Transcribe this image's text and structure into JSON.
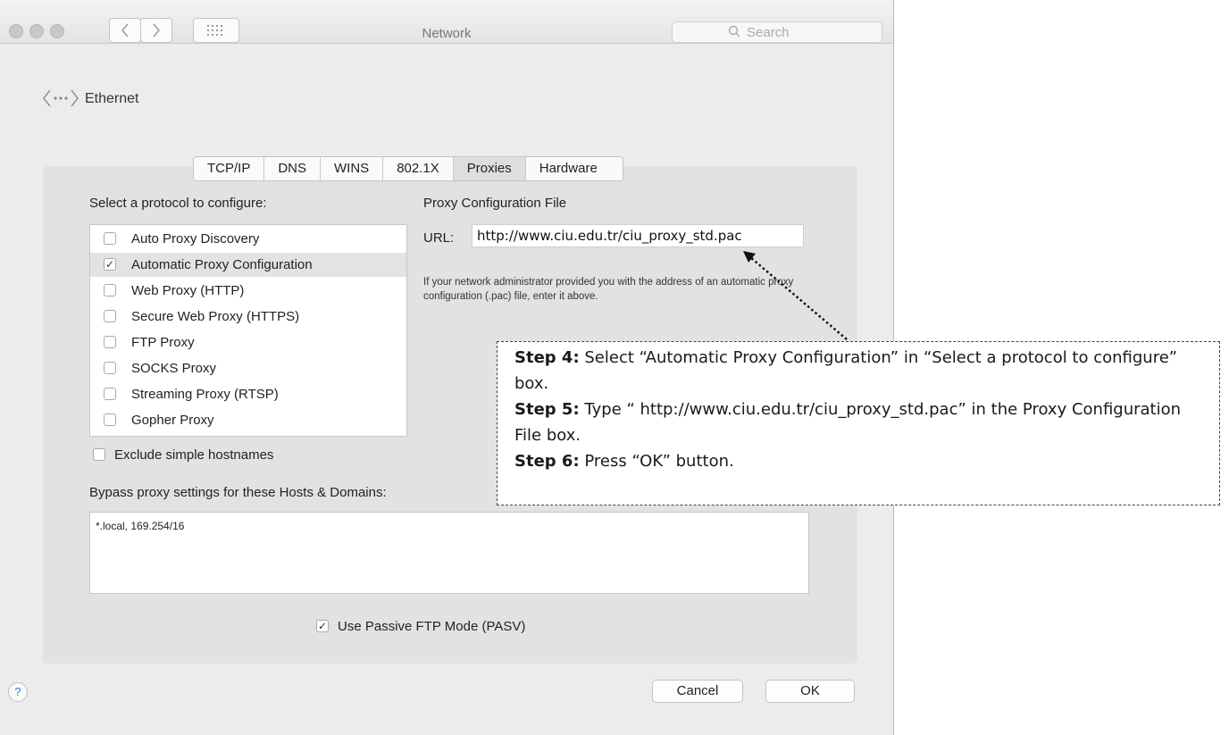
{
  "window": {
    "title": "Network",
    "search_placeholder": "Search"
  },
  "breadcrumb": {
    "label": "Ethernet"
  },
  "tabs": [
    {
      "label": "TCP/IP",
      "selected": false
    },
    {
      "label": "DNS",
      "selected": false
    },
    {
      "label": "WINS",
      "selected": false
    },
    {
      "label": "802.1X",
      "selected": false
    },
    {
      "label": "Proxies",
      "selected": true
    },
    {
      "label": "Hardware",
      "selected": false
    }
  ],
  "protocols": {
    "heading": "Select a protocol to configure:",
    "items": [
      {
        "label": "Auto Proxy Discovery",
        "checked": false,
        "selected": false
      },
      {
        "label": "Automatic Proxy Configuration",
        "checked": true,
        "selected": true
      },
      {
        "label": "Web Proxy (HTTP)",
        "checked": false,
        "selected": false
      },
      {
        "label": "Secure Web Proxy (HTTPS)",
        "checked": false,
        "selected": false
      },
      {
        "label": "FTP Proxy",
        "checked": false,
        "selected": false
      },
      {
        "label": "SOCKS Proxy",
        "checked": false,
        "selected": false
      },
      {
        "label": "Streaming Proxy (RTSP)",
        "checked": false,
        "selected": false
      },
      {
        "label": "Gopher Proxy",
        "checked": false,
        "selected": false
      }
    ]
  },
  "proxy_config": {
    "heading": "Proxy Configuration File",
    "url_label": "URL:",
    "url_value": "http://www.ciu.edu.tr/ciu_proxy_std.pac",
    "help_text": "If your network administrator provided you with the address of an automatic proxy configuration (.pac) file, enter it above."
  },
  "exclude": {
    "label": "Exclude simple hostnames",
    "checked": false
  },
  "bypass": {
    "heading": "Bypass proxy settings for these Hosts & Domains:",
    "value": "*.local, 169.254/16"
  },
  "pasv": {
    "label": "Use Passive FTP Mode (PASV)",
    "checked": true
  },
  "buttons": {
    "help": "?",
    "cancel": "Cancel",
    "ok": "OK"
  },
  "annotation": {
    "steps": [
      {
        "prefix": "Step 4:",
        "text": " Select “Automatic Proxy Configuration” in “Select a protocol to configure” box."
      },
      {
        "prefix": "Step 5:",
        "text": " Type “ http://www.ciu.edu.tr/ciu_proxy_std.pac” in the Proxy Configuration File box."
      },
      {
        "prefix": "Step 6:",
        "text": " Press “OK” button."
      }
    ]
  },
  "colors": {
    "window_bg": "#ececec",
    "panel_bg": "#e2e2e2",
    "selected_row": "#e3e3e3"
  }
}
